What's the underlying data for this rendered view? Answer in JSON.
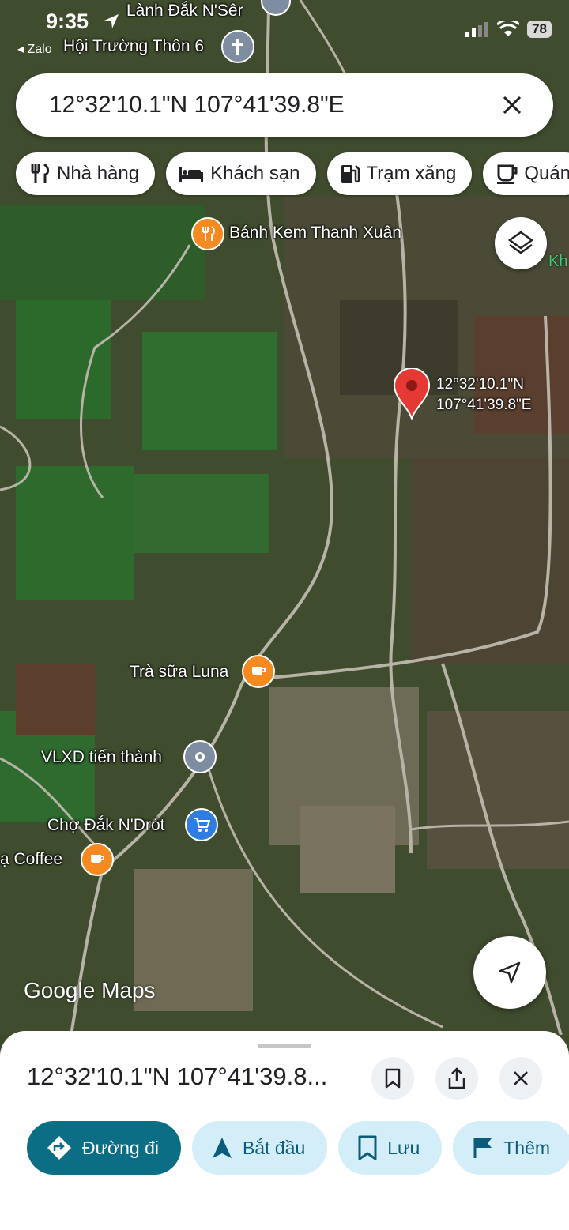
{
  "status_bar": {
    "time": "9:35",
    "back_app": "◂ Zalo",
    "battery": "78"
  },
  "search": {
    "query": "12°32'10.1\"N 107°41'39.8\"E"
  },
  "chips": [
    {
      "label": "Nhà hàng",
      "icon": "restaurant-icon"
    },
    {
      "label": "Khách sạn",
      "icon": "hotel-icon"
    },
    {
      "label": "Trạm xăng",
      "icon": "gas-station-icon"
    },
    {
      "label": "Quán",
      "icon": "cafe-icon"
    }
  ],
  "map": {
    "labels": {
      "top1": "Lành Đắk N'Sêr",
      "top2": "Hội Trường Thôn 6",
      "edge_right": "Kh",
      "banh_kem": "Bánh Kem Thanh Xuân",
      "tra_sua": "Trà sữa Luna",
      "vlxd": "VLXD tiến thành",
      "cho": "Chợ Đắk N'Drót",
      "coffee": "ạ Coffee"
    },
    "pin": {
      "lat": "12°32'10.1\"N",
      "lng": "107°41'39.8\"E",
      "color": "#e53935"
    },
    "attribution": "Google Maps"
  },
  "sheet": {
    "title": "12°32'10.1\"N 107°41'39.8...",
    "actions": [
      {
        "label": "Đường đi",
        "icon": "directions-icon",
        "primary": true
      },
      {
        "label": "Bắt đầu",
        "icon": "navigate-icon"
      },
      {
        "label": "Lưu",
        "icon": "bookmark-icon"
      },
      {
        "label": "Thêm",
        "icon": "flag-icon"
      }
    ]
  },
  "colors": {
    "accent": "#0b6e85",
    "chip_light": "#d3eef8",
    "poi_orange": "#f6891f"
  }
}
